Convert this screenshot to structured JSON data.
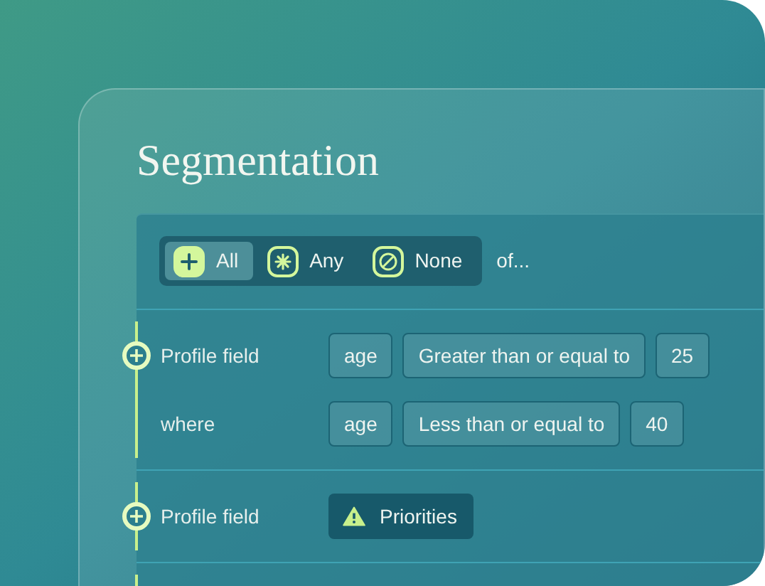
{
  "title": "Segmentation",
  "match_modes": [
    {
      "label": "All",
      "kind": "all",
      "selected": true
    },
    {
      "label": "Any",
      "kind": "any",
      "selected": false
    },
    {
      "label": "None",
      "kind": "none",
      "selected": false
    }
  ],
  "match_suffix": "of...",
  "groups": [
    {
      "conditions": [
        {
          "kind": "comparison",
          "label": "Profile field",
          "field": "age",
          "operator": "Greater than or equal to",
          "value": "25"
        },
        {
          "kind": "comparison",
          "label": "where",
          "field": "age",
          "operator": "Less than or equal to",
          "value": "40"
        }
      ]
    },
    {
      "conditions": [
        {
          "kind": "warning",
          "label": "Profile field",
          "value": "Priorities"
        }
      ]
    }
  ]
}
